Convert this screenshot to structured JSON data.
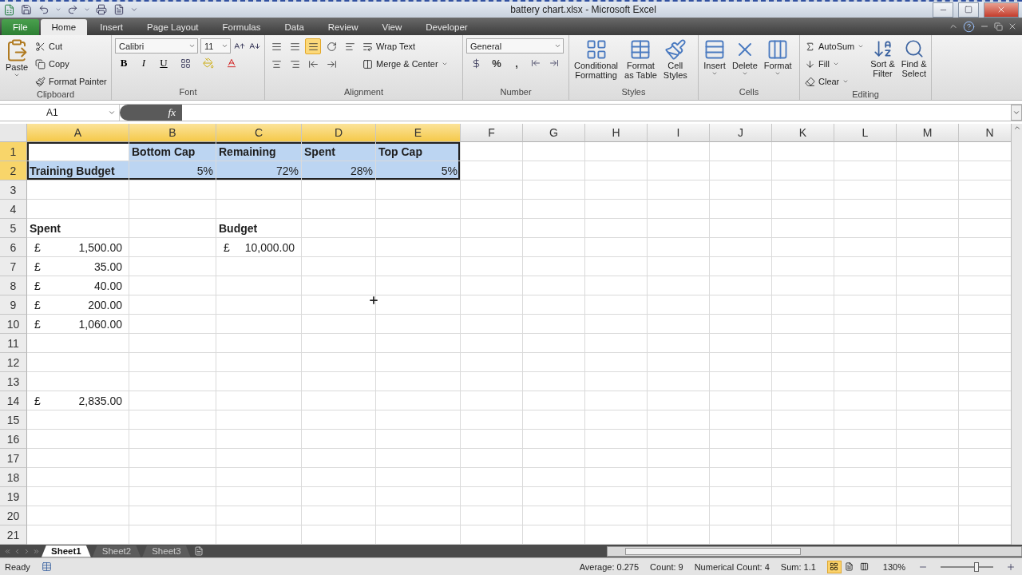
{
  "window": {
    "title": "battery chart.xlsx - Microsoft Excel"
  },
  "ribbon_tabs": [
    {
      "label": "File",
      "kind": "file",
      "selected": false
    },
    {
      "label": "Home",
      "kind": "tab",
      "selected": true
    },
    {
      "label": "Insert",
      "kind": "tab",
      "selected": false
    },
    {
      "label": "Page Layout",
      "kind": "tab",
      "selected": false
    },
    {
      "label": "Formulas",
      "kind": "tab",
      "selected": false
    },
    {
      "label": "Data",
      "kind": "tab",
      "selected": false
    },
    {
      "label": "Review",
      "kind": "tab",
      "selected": false
    },
    {
      "label": "View",
      "kind": "tab",
      "selected": false
    },
    {
      "label": "Developer",
      "kind": "tab",
      "selected": false
    }
  ],
  "ribbon": {
    "clipboard": {
      "label": "Clipboard",
      "paste": "Paste",
      "items": [
        "Cut",
        "Copy",
        "Format Painter"
      ]
    },
    "font": {
      "label": "Font",
      "font_name": "Calibri",
      "font_size": "11",
      "styles": [
        "B",
        "I",
        "U"
      ]
    },
    "alignment": {
      "label": "Alignment",
      "buttons": [
        {
          "selected": false
        },
        {
          "selected": false
        },
        {
          "selected": true
        },
        {
          "selected": false
        },
        {
          "selected": false
        },
        {
          "selected": false
        },
        {
          "selected": false
        },
        {
          "selected": false
        },
        {
          "selected": false
        }
      ],
      "wrap": "Wrap Text",
      "merge": "Merge & Center"
    },
    "number": {
      "label": "Number",
      "format": "General",
      "symbols": [
        "%",
        ","
      ]
    },
    "styles": {
      "label": "Styles",
      "buttons": [
        [
          "Conditional",
          "Formatting"
        ],
        [
          "Format",
          "as Table"
        ],
        [
          "Cell",
          "Styles"
        ]
      ]
    },
    "cells": {
      "label": "Cells",
      "buttons": [
        "Insert",
        "Delete",
        "Format"
      ]
    },
    "editing": {
      "label": "Editing",
      "items": [
        "AutoSum",
        "Fill",
        "Clear"
      ],
      "buttons": [
        [
          "Sort &",
          "Filter"
        ],
        [
          "Find &",
          "Select"
        ]
      ]
    }
  },
  "formula_bar": {
    "name_box": "A1",
    "function_label": "fx"
  },
  "grid": {
    "columns": [
      {
        "label": "A",
        "selected": true
      },
      {
        "label": "B",
        "selected": true
      },
      {
        "label": "C",
        "selected": true
      },
      {
        "label": "D",
        "selected": true
      },
      {
        "label": "E",
        "selected": true
      },
      {
        "label": "F",
        "selected": false
      },
      {
        "label": "G",
        "selected": false
      },
      {
        "label": "H",
        "selected": false
      },
      {
        "label": "I",
        "selected": false
      },
      {
        "label": "J",
        "selected": false
      },
      {
        "label": "K",
        "selected": false
      },
      {
        "label": "L",
        "selected": false
      },
      {
        "label": "M",
        "selected": false
      },
      {
        "label": "N",
        "selected": false
      }
    ],
    "rows": [
      {
        "label": "1",
        "selected": true,
        "cells": [
          {
            "active": true
          },
          {
            "kind": "text",
            "bold": true,
            "text": "Bottom Cap"
          },
          {
            "kind": "text",
            "bold": true,
            "text": "Remaining"
          },
          {
            "kind": "text",
            "bold": true,
            "text": "Spent"
          },
          {
            "kind": "text",
            "bold": true,
            "text": "Top Cap"
          }
        ]
      },
      {
        "label": "2",
        "selected": true,
        "cells": [
          {
            "kind": "text",
            "bold": true,
            "text": "Training Budget"
          },
          {
            "kind": "number",
            "text": "5%"
          },
          {
            "kind": "number",
            "text": "72%"
          },
          {
            "kind": "number",
            "text": "28%"
          },
          {
            "kind": "number",
            "text": "5%"
          }
        ]
      },
      {
        "label": "3",
        "selected": false
      },
      {
        "label": "4",
        "selected": false
      },
      {
        "label": "5",
        "selected": false,
        "cells": [
          {
            "kind": "text",
            "bold": true,
            "text": "Spent"
          },
          {},
          {
            "kind": "text",
            "bold": true,
            "text": "Budget"
          }
        ]
      },
      {
        "label": "6",
        "selected": false,
        "cells": [
          {
            "kind": "currency",
            "symbol": "£",
            "text": "1,500.00"
          },
          {},
          {
            "kind": "currency",
            "symbol": "£",
            "text": "10,000.00"
          }
        ]
      },
      {
        "label": "7",
        "selected": false,
        "cells": [
          {
            "kind": "currency",
            "symbol": "£",
            "text": "35.00"
          }
        ]
      },
      {
        "label": "8",
        "selected": false,
        "cells": [
          {
            "kind": "currency",
            "symbol": "£",
            "text": "40.00"
          }
        ]
      },
      {
        "label": "9",
        "selected": false,
        "cells": [
          {
            "kind": "currency",
            "symbol": "£",
            "text": "200.00"
          }
        ]
      },
      {
        "label": "10",
        "selected": false,
        "cells": [
          {
            "kind": "currency",
            "symbol": "£",
            "text": "1,060.00"
          }
        ]
      },
      {
        "label": "11",
        "selected": false
      },
      {
        "label": "12",
        "selected": false
      },
      {
        "label": "13",
        "selected": false
      },
      {
        "label": "14",
        "selected": false,
        "cells": [
          {
            "kind": "currency",
            "symbol": "£",
            "text": "2,835.00"
          }
        ]
      },
      {
        "label": "15",
        "selected": false
      },
      {
        "label": "16",
        "selected": false
      },
      {
        "label": "17",
        "selected": false
      },
      {
        "label": "18",
        "selected": false
      },
      {
        "label": "19",
        "selected": false
      },
      {
        "label": "20",
        "selected": false
      },
      {
        "label": "21",
        "selected": false
      }
    ]
  },
  "sheet_tabs": [
    {
      "label": "Sheet1",
      "selected": true
    },
    {
      "label": "Sheet2",
      "selected": false
    },
    {
      "label": "Sheet3",
      "selected": false
    }
  ],
  "status_bar": {
    "mode": "Ready",
    "stats": [
      "Average: 0.275",
      "Count: 9",
      "Numerical Count: 4",
      "Sum: 1.1"
    ],
    "views": [
      {
        "selected": true
      },
      {
        "selected": false
      },
      {
        "selected": false
      }
    ],
    "zoom": "130%",
    "zoom_slider": {
      "level": 0.68
    }
  }
}
